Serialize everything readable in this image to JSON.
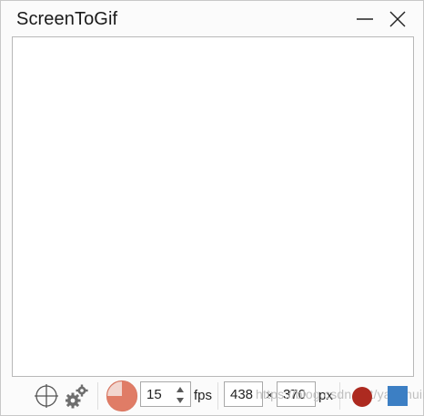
{
  "window": {
    "title": "ScreenToGif",
    "minimize_icon": "minimize-icon",
    "close_icon": "close-icon"
  },
  "toolbar": {
    "snap_icon": "crosshair-icon",
    "settings_icon": "gears-icon",
    "frame_rate_icon": "pie-clock-icon",
    "fps_value": "15",
    "fps_unit": "fps",
    "width_value": "438",
    "size_separator": "×",
    "height_value": "370",
    "size_unit": "px",
    "watermark": "https://blog.csdn.net/yanzhuin",
    "record_icon": "record-icon",
    "stop_icon": "stop-icon"
  },
  "colors": {
    "record": "#ad2a20",
    "stop": "#3c7fc4",
    "pie_fill": "#e07c66",
    "pie_light": "#f2d6cf"
  }
}
